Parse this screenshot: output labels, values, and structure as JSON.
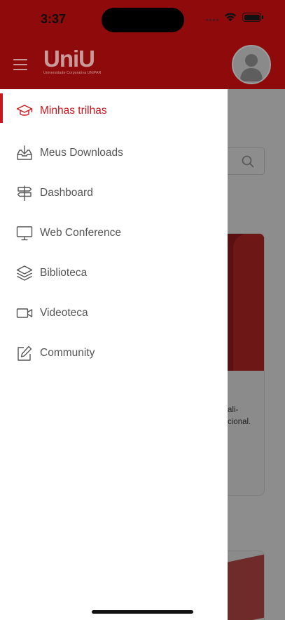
{
  "status_bar": {
    "time": "3:37"
  },
  "header": {
    "logo_text": "UniU",
    "logo_subtitle": "Universidade Corporativa UNIPAR"
  },
  "background": {
    "card_text_line1": "ali-",
    "card_text_line2": "cional."
  },
  "menu": {
    "items": [
      {
        "label": "Minhas trilhas",
        "icon": "graduation-cap-icon",
        "active": true
      },
      {
        "label": "Meus Downloads",
        "icon": "download-tray-icon",
        "active": false
      },
      {
        "label": "Dashboard",
        "icon": "signpost-icon",
        "active": false
      },
      {
        "label": "Web Conference",
        "icon": "monitor-icon",
        "active": false
      },
      {
        "label": "Biblioteca",
        "icon": "layers-icon",
        "active": false
      },
      {
        "label": "Videoteca",
        "icon": "video-camera-icon",
        "active": false
      },
      {
        "label": "Community",
        "icon": "edit-icon",
        "active": false
      }
    ]
  },
  "colors": {
    "brand_red": "#c8171d",
    "header_bg": "#8f0b0b"
  }
}
